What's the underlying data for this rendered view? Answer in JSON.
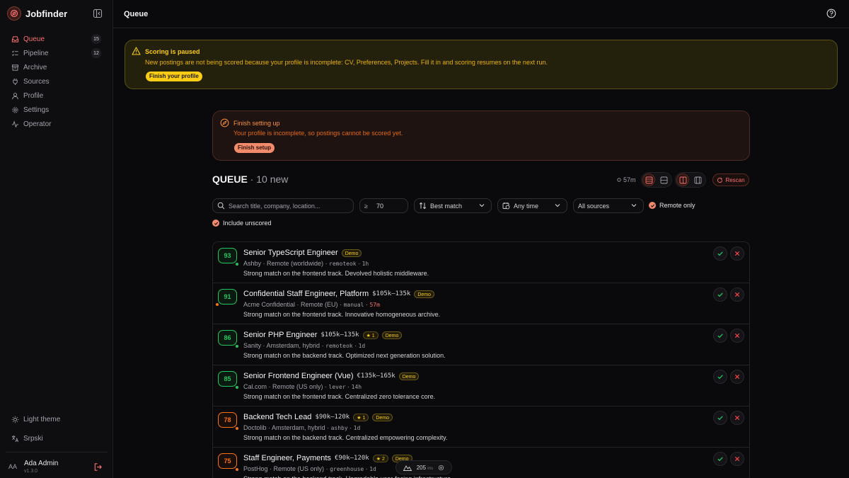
{
  "app": {
    "name": "Jobfinder"
  },
  "sidebar": {
    "items": [
      {
        "label": "Queue",
        "badge": "15",
        "icon": "inbox-icon"
      },
      {
        "label": "Pipeline",
        "badge": "12",
        "icon": "list-check-icon"
      },
      {
        "label": "Archive",
        "icon": "archive-icon"
      },
      {
        "label": "Sources",
        "icon": "plug-icon"
      },
      {
        "label": "Profile",
        "icon": "user-icon"
      },
      {
        "label": "Settings",
        "icon": "gear-icon"
      },
      {
        "label": "Operator",
        "icon": "activity-icon"
      }
    ],
    "theme_label": "Light theme",
    "language_label": "Srpski",
    "user": {
      "initials": "AA",
      "name": "Ada Admin",
      "version": "v1.3.0"
    }
  },
  "header": {
    "title": "Queue"
  },
  "warning": {
    "title": "Scoring is paused",
    "text": "New postings are not being scored because your profile is incomplete: CV, Preferences, Projects. Fill it in and scoring resumes on the next run.",
    "button": "Finish your profile"
  },
  "setup": {
    "title": "Finish setting up",
    "text": "Your profile is incomplete, so postings cannot be scored yet.",
    "button": "Finish setup"
  },
  "queue": {
    "heading": "QUEUE",
    "count": " · 10 new",
    "age": "57m",
    "rescan": "Rescan"
  },
  "filters": {
    "search_placeholder": "Search title, company, location...",
    "min_prefix": "≥",
    "min_score": "70",
    "sort": "Best match",
    "time": "Any time",
    "sources": "All sources",
    "remote_only": "Remote only",
    "include_unscored": "Include unscored"
  },
  "jobs": [
    {
      "score": "93",
      "tier": "green",
      "dot": "#22c55e",
      "title": "Senior TypeScript Engineer",
      "salary": "",
      "stars": "",
      "demo": "Demo",
      "company": "Ashby",
      "location": "Remote (worldwide)",
      "source": "remoteok",
      "age": "1h",
      "age_hot": false,
      "summary": "Strong match on the frontend track. Devolved holistic middleware."
    },
    {
      "score": "91",
      "tier": "green",
      "dot": "#f97316",
      "title": "Confidential Staff Engineer, Platform",
      "salary": "$105k–135k",
      "stars": "",
      "demo": "Demo",
      "company": "Acme Confidential",
      "location": "Remote (EU)",
      "source": "manual",
      "age": "57m",
      "age_hot": true,
      "summary": "Strong match on the frontend track. Innovative homogeneous archive."
    },
    {
      "score": "86",
      "tier": "green",
      "dot": "#22c55e",
      "title": "Senior PHP Engineer",
      "salary": "$105k–135k",
      "stars": "1",
      "demo": "Demo",
      "company": "Sanity",
      "location": "Amsterdam, hybrid",
      "source": "remoteok",
      "age": "1d",
      "age_hot": false,
      "summary": "Strong match on the backend track. Optimized next generation solution."
    },
    {
      "score": "85",
      "tier": "green",
      "dot": "#22c55e",
      "title": "Senior Frontend Engineer (Vue)",
      "salary": "€135k–165k",
      "stars": "",
      "demo": "Demo",
      "company": "Cal.com",
      "location": "Remote (US only)",
      "source": "lever",
      "age": "14h",
      "age_hot": false,
      "summary": "Strong match on the frontend track. Centralized zero tolerance core."
    },
    {
      "score": "78",
      "tier": "orange",
      "dot": "#f97316",
      "title": "Backend Tech Lead",
      "salary": "$90k–120k",
      "stars": "1",
      "demo": "Demo",
      "company": "Doctolib",
      "location": "Amsterdam, hybrid",
      "source": "ashby",
      "age": "1d",
      "age_hot": false,
      "summary": "Strong match on the backend track. Centralized empowering complexity."
    },
    {
      "score": "75",
      "tier": "orange",
      "dot": "#f97316",
      "title": "Staff Engineer, Payments",
      "salary": "€90k–120k",
      "stars": "2",
      "demo": "Demo",
      "company": "PostHog",
      "location": "Remote (US only)",
      "source": "greenhouse",
      "age": "1d",
      "age_hot": false,
      "summary": "Strong match on the backend track. Upgradable user-facing infrastructure."
    }
  ],
  "perf": {
    "value": "205",
    "unit": "ms"
  },
  "colors": {
    "accent": "#f87171",
    "warning": "#facc15",
    "good": "#22c55e",
    "mid": "#f97316"
  }
}
